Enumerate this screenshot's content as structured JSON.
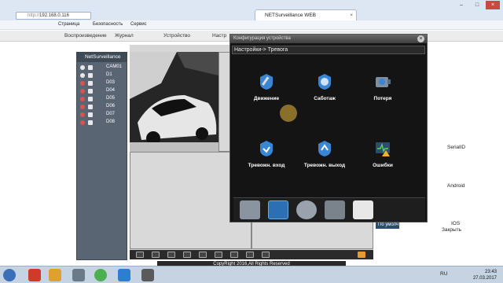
{
  "browser": {
    "address_prefix": "http://",
    "address": "192.168.0.116",
    "tab_title": "NETSurveillance WEB",
    "tab_close": "×",
    "window_buttons": [
      "–",
      "□",
      "×"
    ],
    "cmd": {
      "page": "Страница",
      "safety": "Безопасность",
      "service": "Сервис"
    }
  },
  "app_nav": {
    "items": [
      "Воспроизведение",
      "Журнал",
      "Устройство",
      "Настр"
    ]
  },
  "devices": {
    "root": "NetSurveillance",
    "items": [
      {
        "label": "CAM01",
        "status": "online"
      },
      {
        "label": "D1",
        "status": "online"
      },
      {
        "label": "D03",
        "status": "offline"
      },
      {
        "label": "D04",
        "status": "offline"
      },
      {
        "label": "D05",
        "status": "offline"
      },
      {
        "label": "D06",
        "status": "offline"
      },
      {
        "label": "D07",
        "status": "offline"
      },
      {
        "label": "D08",
        "status": "offline"
      }
    ]
  },
  "footer": {
    "copyright": "CopyRight 2016,All Rights Reserved"
  },
  "right_panel": {
    "serial": "SerialID",
    "android": "Android",
    "ios": "IOS",
    "close": "Закрыть",
    "ip_button": "По умолч"
  },
  "dialog": {
    "title": "Конфигурация устройства",
    "close": "×",
    "breadcrumb": "Настройки-> Тревога",
    "options": [
      {
        "label": "Движение",
        "icon": "motion-detect-icon"
      },
      {
        "label": "Саботаж",
        "icon": "tamper-icon"
      },
      {
        "label": "Потеря",
        "icon": "video-loss-icon"
      },
      {
        "label": "Тревожн. вход",
        "icon": "alarm-input-icon"
      },
      {
        "label": "Тревожн. выход",
        "icon": "alarm-output-icon"
      },
      {
        "label": "Ошибки",
        "icon": "error-icon"
      }
    ],
    "dock": [
      "storage-icon",
      "alarm-shield-icon",
      "settings-gear-icon",
      "tools-icon",
      "info-list-icon"
    ]
  },
  "taskbar": {
    "lang": "RU",
    "time": "23:43",
    "date": "27.03.2017"
  },
  "colors": {
    "dialog_bg": "#141414",
    "accent_blue": "#2c6fb3",
    "panel_bg": "#5a6573"
  }
}
